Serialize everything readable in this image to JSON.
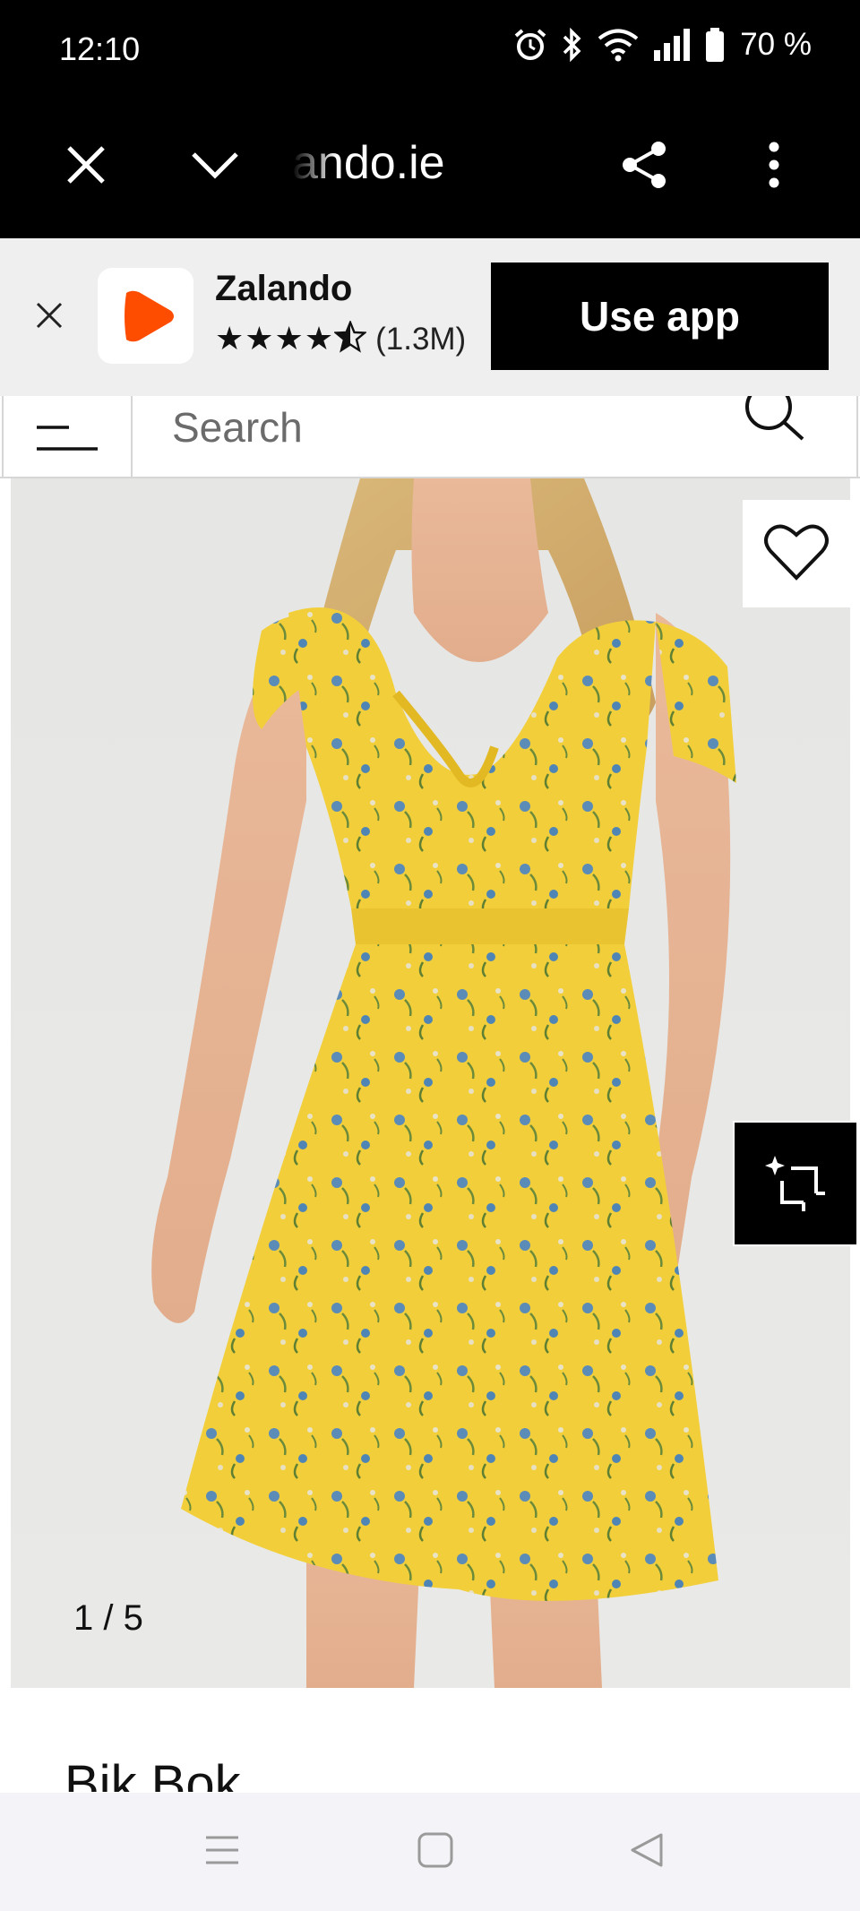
{
  "status_bar": {
    "time": "12:10",
    "battery": "70 %",
    "icons": [
      "alarm-icon",
      "bluetooth-icon",
      "wifi-icon",
      "signal-icon",
      "battery-icon"
    ]
  },
  "browser": {
    "url": "ando.ie",
    "icons": [
      "close-icon",
      "chevron-down-icon",
      "share-icon",
      "more-vert-icon"
    ]
  },
  "app_banner": {
    "app_name": "Zalando",
    "rating_count": "(1.3M)",
    "stars": "★★★★",
    "rating": 4.5,
    "button_label": "Use app",
    "accent_color": "#ff4d00"
  },
  "search": {
    "placeholder": "Search"
  },
  "product": {
    "image_counter": "1 / 5",
    "brand": "Bik Bok",
    "dress_color": "#f2cf3a"
  },
  "nav": {
    "icons": [
      "recents-icon",
      "home-icon",
      "back-icon"
    ]
  }
}
